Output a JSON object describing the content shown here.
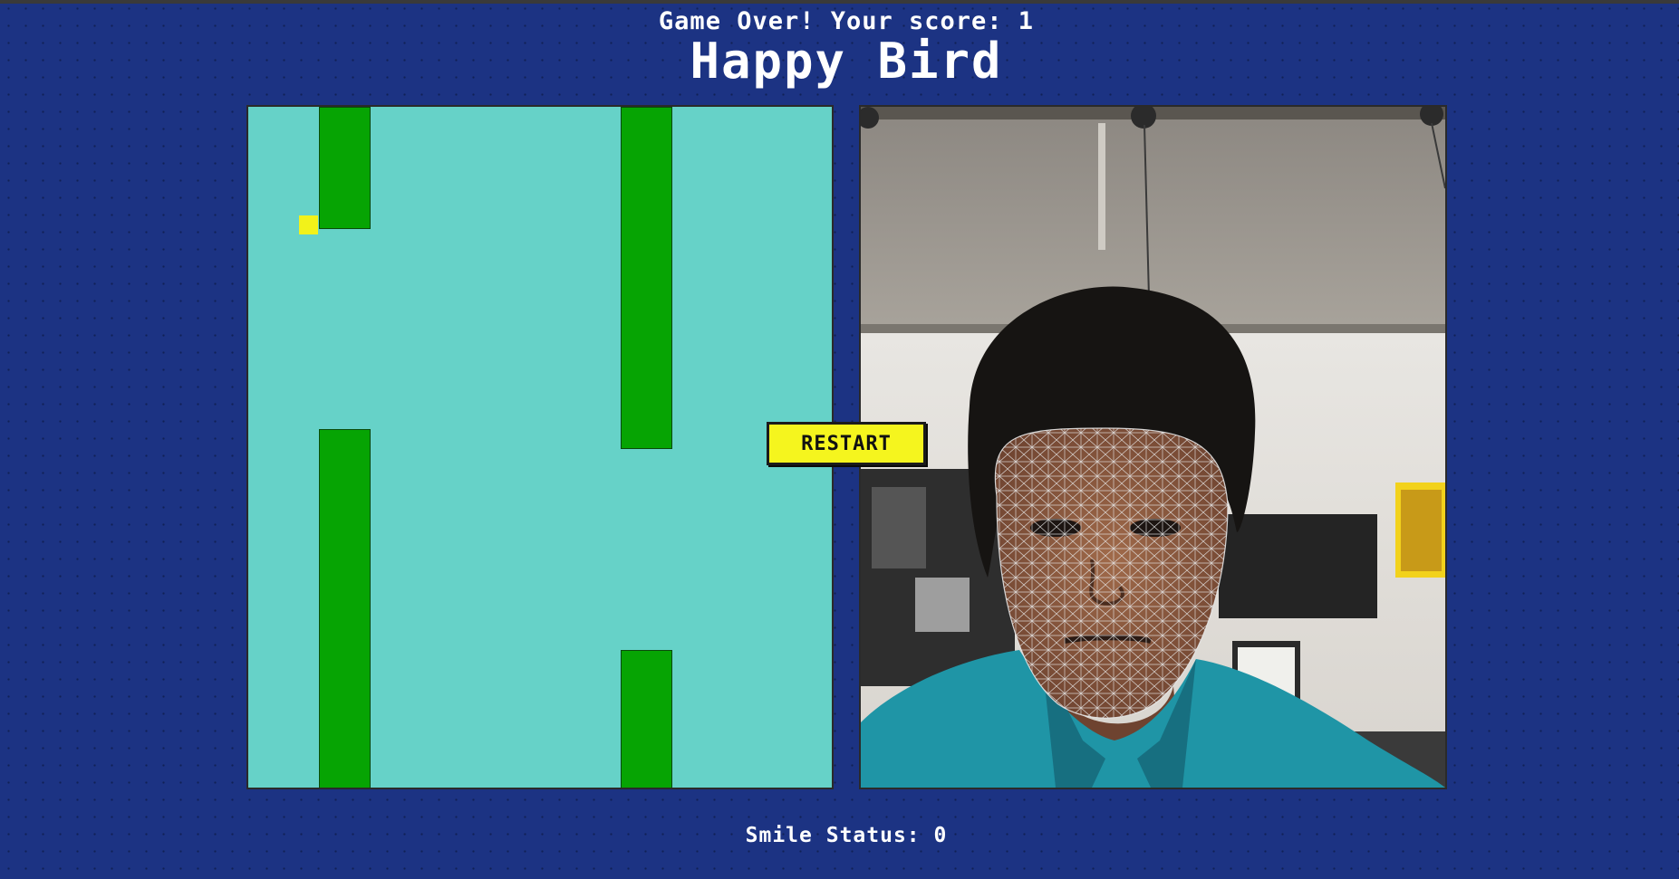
{
  "status": {
    "message": "Game Over! Your score: 1"
  },
  "title": "Happy Bird",
  "game": {
    "sky_color": "#66d2c8",
    "pipe_color": "#06a403",
    "bird_color": "#f2f21a"
  },
  "restart_button": {
    "label": "RESTART"
  },
  "smile_status": {
    "text": "Smile Status: 0"
  },
  "webcam": {
    "overlay": "face-mesh"
  }
}
